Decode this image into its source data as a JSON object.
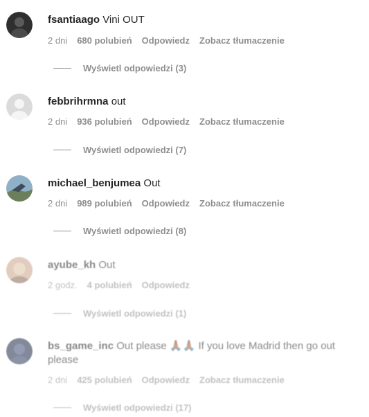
{
  "comments": [
    {
      "username": "fsantiaago",
      "text": "Vini OUT",
      "time": "2 dni",
      "likes": "680 polubień",
      "reply": "Odpowiedz",
      "translate": "Zobacz tłumaczenie",
      "view_replies": "Wyświetl odpowiedzi (3)",
      "avatar_color": "#2a2a2a"
    },
    {
      "username": "febbrihrmna",
      "text": "out",
      "time": "2 dni",
      "likes": "936 polubień",
      "reply": "Odpowiedz",
      "translate": "Zobacz tłumaczenie",
      "view_replies": "Wyświetl odpowiedzi (7)",
      "avatar_color": "#dbdbdb"
    },
    {
      "username": "michael_benjumea",
      "text": "Out",
      "time": "2 dni",
      "likes": "989 polubień",
      "reply": "Odpowiedz",
      "translate": "Zobacz tłumaczenie",
      "view_replies": "Wyświetl odpowiedzi (8)",
      "avatar_color": "#6b8fa8"
    },
    {
      "username": "ayube_kh",
      "text": "Out",
      "time": "2 godz.",
      "likes": "4 polubień",
      "reply": "Odpowiedz",
      "translate": "",
      "view_replies": "Wyświetl odpowiedzi (1)",
      "avatar_color": "#c9a48a"
    },
    {
      "username": "bs_game_inc",
      "text": "Out please 🙏🏾🙏🏾 If you love Madrid then go out please",
      "time": "2 dni",
      "likes": "425 polubień",
      "reply": "Odpowiedz",
      "translate": "Zobacz tłumaczenie",
      "view_replies": "Wyświetl odpowiedzi (17)",
      "avatar_color": "#1f2a44"
    }
  ],
  "colors": {
    "primary_text": "#262626",
    "secondary_text": "#8e8e8e",
    "background": "#ffffff"
  }
}
